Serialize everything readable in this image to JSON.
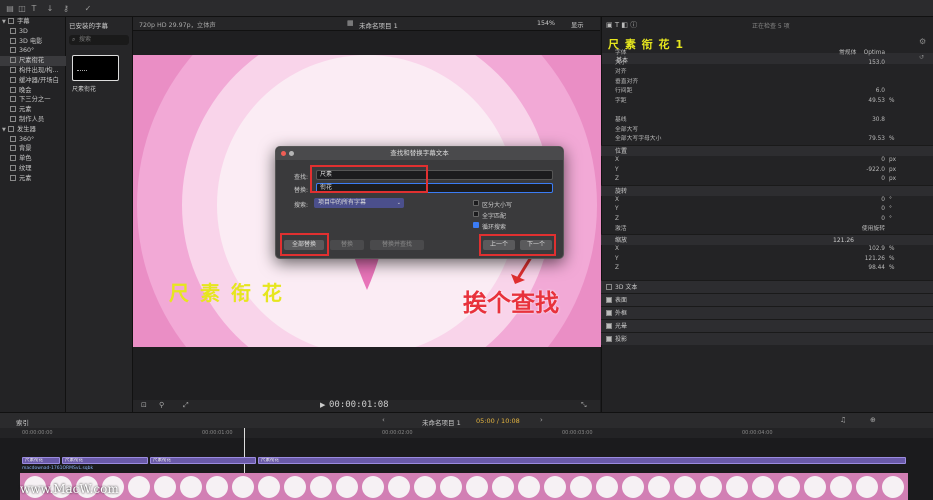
{
  "toolbar": {
    "installed_subtitles": "已安装的字幕",
    "format": "720p HD 29.97p，立体声",
    "project_name": "未命名项目 1",
    "zoom": "154%",
    "display": "显示",
    "inspecting": "正在检查 5 项"
  },
  "sidebar": {
    "items": [
      {
        "label": "字幕",
        "type": "group"
      },
      {
        "label": "3D",
        "type": "item"
      },
      {
        "label": "3D 电影",
        "type": "item"
      },
      {
        "label": "360°",
        "type": "item"
      },
      {
        "label": "尺素衔花",
        "type": "item",
        "selected": true
      },
      {
        "label": "构件出现/构...",
        "type": "item"
      },
      {
        "label": "缓冲器/开场白",
        "type": "item"
      },
      {
        "label": "晚会",
        "type": "item"
      },
      {
        "label": "下三分之一",
        "type": "item"
      },
      {
        "label": "元素",
        "type": "item"
      },
      {
        "label": "制作人员",
        "type": "item"
      },
      {
        "label": "发生器",
        "type": "group"
      },
      {
        "label": "360°",
        "type": "item"
      },
      {
        "label": "背景",
        "type": "item"
      },
      {
        "label": "单色",
        "type": "item"
      },
      {
        "label": "纹理",
        "type": "item"
      },
      {
        "label": "元素",
        "type": "item"
      }
    ]
  },
  "browser": {
    "search_placeholder": "搜索",
    "clip_name": "尺素衔花"
  },
  "canvas": {
    "title_text": "尺 素 衔 花",
    "annotation": "挨个查找",
    "bg_color": "#ea8ec5",
    "title_color": "#e6e61e"
  },
  "dialog": {
    "title": "查找和替换字幕文本",
    "find_label": "查找:",
    "find_value": "尺素",
    "replace_label": "替换:",
    "replace_value": "衔花",
    "search_label": "搜索:",
    "search_scope": "项目中的所有字幕",
    "opt_case": "区分大小写",
    "opt_whole": "全字匹配",
    "opt_loop": "循环搜索",
    "btn_replace_all": "全部替换",
    "btn_replace": "替换",
    "btn_replace_find": "替换并查找",
    "btn_prev": "上一个",
    "btn_next": "下一个"
  },
  "viewer": {
    "timecode": "00:00:01:08"
  },
  "inspector": {
    "title": "尺 素 衔 花 1",
    "section_basic": "基本",
    "rows": [
      {
        "label": "字体",
        "value": "Optima",
        "extra": "常规体"
      },
      {
        "label": "大小",
        "value": "153.0"
      },
      {
        "label": "对齐",
        "value": ""
      },
      {
        "label": "垂直对齐",
        "value": ""
      },
      {
        "label": "行间距",
        "value": "6.0"
      },
      {
        "label": "字距",
        "value": "49.53",
        "unit": "%"
      },
      {
        "label": "",
        "value": ""
      },
      {
        "label": "基线",
        "value": "30.8"
      },
      {
        "label": "全部大写",
        "value": ""
      },
      {
        "label": "全部大写字母大小",
        "value": "79.53",
        "unit": "%"
      }
    ],
    "section_position": "位置",
    "position": [
      {
        "label": "X",
        "value": "0",
        "unit": "px"
      },
      {
        "label": "Y",
        "value": "-922.0",
        "unit": "px"
      },
      {
        "label": "Z",
        "value": "0",
        "unit": "px"
      }
    ],
    "section_rotation": "旋转",
    "rotation": [
      {
        "label": "X",
        "value": "0",
        "unit": "°"
      },
      {
        "label": "Y",
        "value": "0",
        "unit": "°"
      },
      {
        "label": "Z",
        "value": "0",
        "unit": "°"
      }
    ],
    "animate_label": "激活",
    "animate_value": "使用旋转",
    "section_scale": "缩放",
    "scale_all": "121.26",
    "scale": [
      {
        "label": "X",
        "value": "102.9",
        "unit": "%"
      },
      {
        "label": "Y",
        "value": "121.26",
        "unit": "%"
      },
      {
        "label": "Z",
        "value": "98.44",
        "unit": "%"
      }
    ],
    "sections": [
      "3D 文本",
      "表面",
      "外框",
      "光晕",
      "投影"
    ]
  },
  "timeline": {
    "index_label": "索引",
    "project_name": "未命名项目 1",
    "duration": "05:00 / 10:08",
    "ruler": [
      "00:00:00:00",
      "00:00:01:00",
      "00:00:02:00",
      "00:00:03:00",
      "00:00:04:00"
    ],
    "clip_labels": [
      "尺素衔花",
      "尺素衔花",
      "尺素衔花",
      "尺素衔花"
    ],
    "media_label": "macdownad-1761ORMSvL.sqbk",
    "watermark": "www.MacW.com"
  }
}
